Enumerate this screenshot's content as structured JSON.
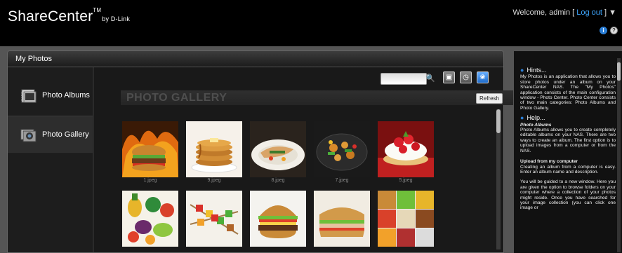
{
  "header": {
    "brand": "ShareCenter",
    "brand_tm": "TM",
    "brand_by": "by D-Link",
    "welcome": "Welcome, admin [",
    "logout": "Log out",
    "welcome_end": "] ▼",
    "info_glyph": "i",
    "help_glyph": "?"
  },
  "panel": {
    "title": "My Photos"
  },
  "nav": {
    "items": [
      {
        "label": "Photo Albums",
        "icon": "photo-album-icon"
      },
      {
        "label": "Photo Gallery",
        "icon": "photo-gallery-icon"
      }
    ]
  },
  "toolbar": {
    "search_glyph": "🔍",
    "btn1_glyph": "▣",
    "btn2_glyph": "◷",
    "btn3_glyph": "❀"
  },
  "gallery": {
    "title": "PHOTO GALLERY",
    "refresh_label": "Refresh",
    "photos": [
      {
        "caption": "1.jpeg",
        "icon": "burger-photo"
      },
      {
        "caption": "9.jpeg",
        "icon": "pancakes-photo"
      },
      {
        "caption": "8.jpeg",
        "icon": "fish-dish-photo"
      },
      {
        "caption": "7.jpeg",
        "icon": "stirfry-photo"
      },
      {
        "caption": "5.jpeg",
        "icon": "strawberry-tart-photo"
      },
      {
        "caption": "",
        "icon": "vegetables-photo"
      },
      {
        "caption": "",
        "icon": "kebabs-photo"
      },
      {
        "caption": "",
        "icon": "hamburger-photo"
      },
      {
        "caption": "",
        "icon": "sandwich-photo"
      },
      {
        "caption": "",
        "icon": "food-collage-photo"
      }
    ]
  },
  "sidebar": {
    "hints_title": "Hints...",
    "hints_text": "My Photos is an application that allows you to store photos under an album on your ShareCenter NAS. The \"My Photos\" application consists of the main configuration window - Photo Center. Photo Center consists of two main categories: Photo Albums and Photo Gallery.",
    "help_title": "Help...",
    "help_sub": "Photo Albums",
    "help_text": "Photo Albums allows you to create completely editable albums on your NAS. There are two ways to create an album. The first option is to upload images from a computer or from the NAS.",
    "upload_title": "Upload from my computer",
    "upload_text": "Creating an album from a computer is easy. Enter an album name and description.",
    "guide_text": "You will be guided to a new window. Here you are given the option to browse folders on your computer where a collection of your photos might reside. Once you have searched for your image collection (you can click one image or"
  },
  "colors": {
    "accent": "#2c7fd6",
    "link": "#3ea7ff",
    "panel_bg": "#2a2a2a",
    "page_bg": "#555555"
  }
}
